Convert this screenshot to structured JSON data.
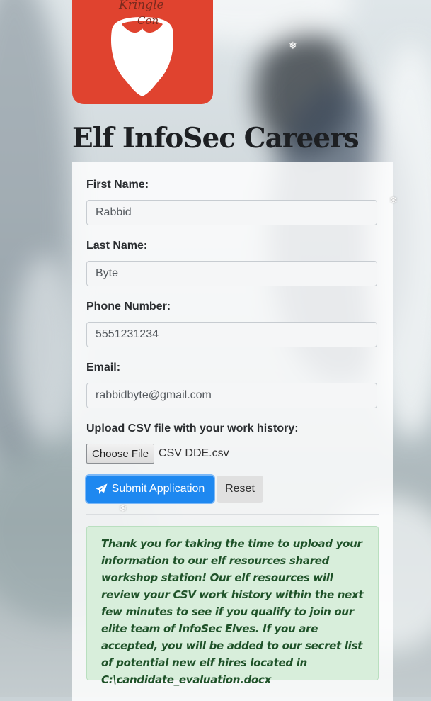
{
  "logo": {
    "text_line1": "Kringle",
    "text_line2": "Con"
  },
  "page": {
    "title": "Elf InfoSec Careers"
  },
  "form": {
    "first_name": {
      "label": "First Name:",
      "value": "Rabbid"
    },
    "last_name": {
      "label": "Last Name:",
      "value": "Byte"
    },
    "phone": {
      "label": "Phone Number:",
      "value": "5551231234"
    },
    "email": {
      "label": "Email:",
      "value": "rabbidbyte@gmail.com"
    },
    "upload": {
      "label": "Upload CSV file with your work history:",
      "button": "Choose File",
      "file_name": "CSV DDE.csv"
    },
    "submit_label": "Submit Application",
    "reset_label": "Reset"
  },
  "alert": {
    "message": "Thank you for taking the time to upload your information to our elf resources shared workshop station! Our elf resources will review your CSV work history within the next few minutes to see if you qualify to join our elite team of InfoSec Elves. If you are accepted, you will be added to our secret list of potential new elf hires located in C:\\candidate_evaluation.docx"
  },
  "icons": {
    "submit": "paper-plane-icon",
    "decor": "snowflake-icon"
  },
  "colors": {
    "logo_bg": "#e0432f",
    "primary": "#1e88f0",
    "alert_bg": "#d8eedb",
    "alert_text": "#1f5229"
  }
}
